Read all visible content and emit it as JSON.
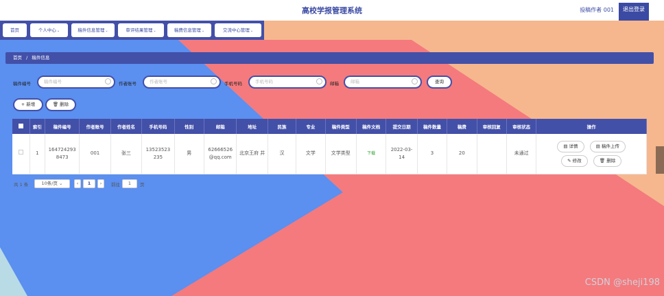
{
  "app": {
    "title": "高校学报管理系统",
    "user": "投稿作者 001",
    "logout": "退出登录"
  },
  "nav": [
    {
      "label": "首页"
    },
    {
      "label": "个人中心"
    },
    {
      "label": "稿件信息管理"
    },
    {
      "label": "审评结果管理"
    },
    {
      "label": "稿费信息管理"
    },
    {
      "label": "交流中心管理"
    }
  ],
  "breadcrumb": {
    "home": "首页",
    "sep": "/",
    "current": "稿件信息"
  },
  "search": {
    "manuscript_no_label": "稿件编号",
    "manuscript_no_placeholder": "稿件编号",
    "author_account_label": "作者账号",
    "author_account_placeholder": "作者账号",
    "phone_label": "手机号码",
    "phone_placeholder": "手机号码",
    "email_label": "邮箱",
    "email_placeholder": "邮箱",
    "query_button": "查询"
  },
  "actions": {
    "add": "+ 新增",
    "delete": "删除"
  },
  "table": {
    "headers": [
      "索引",
      "稿件编号",
      "作者账号",
      "作者姓名",
      "手机号码",
      "性别",
      "邮箱",
      "地址",
      "民族",
      "专业",
      "稿件类型",
      "稿件文档",
      "提交日期",
      "稿件数量",
      "稿费",
      "审核回复",
      "审核状态",
      "操作"
    ],
    "rows": [
      {
        "index": "1",
        "manuscript_no": "164724293 8473",
        "author_account": "001",
        "author_name": "张三",
        "phone": "13523523 235",
        "gender": "男",
        "email": "62666526 @qq.com",
        "address": "北京王府 井",
        "ethnicity": "汉",
        "major": "文学",
        "type": "文学类型",
        "document": "下载",
        "date": "2022-03- 14",
        "count": "3",
        "fee": "20",
        "reply": "",
        "status": "未通过",
        "ops": {
          "detail": "详情",
          "upload": "稿件上传",
          "edit": "修改",
          "delete": "删除"
        }
      }
    ]
  },
  "pagination": {
    "total": "共 1 条",
    "page_size": "10条/页",
    "current_page": "1",
    "goto_label": "前往",
    "goto_value": "1",
    "unit": "页"
  },
  "watermark": "CSDN @sheji198",
  "colors": {
    "primary": "#4350a8",
    "bg_blue": "#5b8ff0",
    "bg_pink": "#f47a7e",
    "bg_peach": "#f6b78e"
  }
}
